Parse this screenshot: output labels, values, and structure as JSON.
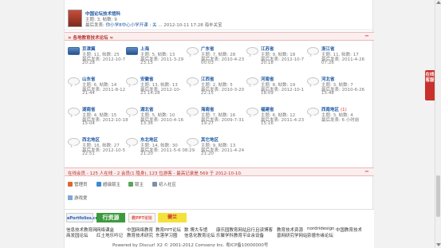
{
  "top": {
    "title": "中国论坛技术馆科",
    "stats": "主题: 3, 帖数: 9",
    "last_prefix": "最后发表:",
    "last_post": "你小学8中心小学开课 : 关",
    "last_time": "... 2012-10-11 17:28 海丰关宝"
  },
  "section": {
    "title": "≈ 各地教育技术论坛 ≈",
    "collapse": "−"
  },
  "cities": [
    {
      "name": "京津冀",
      "new": "",
      "l1": "主题: 11, 帖数: 25",
      "l2": "最后发表: 2012-10-7",
      "l3": "20:28"
    },
    {
      "name": "上海",
      "new": "",
      "l1": "主题: 5, 帖数: 13",
      "l2": "最后发表: 2011-3-29",
      "l3": "23:15"
    },
    {
      "name": "广东省",
      "new": "",
      "l1": "主题: 7, 帖数: 28",
      "l2": "最后发表: 2010-4-23",
      "l3": "00:03"
    },
    {
      "name": "江苏省",
      "new": "",
      "l1": "主题: 9, 帖数: 18",
      "l2": "最后发表: 2012-10-7",
      "l3": "20:18"
    },
    {
      "name": "浙江省",
      "new": "",
      "l1": "主题: 11, 帖数: 17",
      "l2": "最后发表: 2011-4-26",
      "l3": "07:26"
    },
    {
      "name": "山东省",
      "new": "",
      "l1": "主题: 6, 帖数: 14",
      "l2": "最后发表: 2011-8-12",
      "l3": "21:44"
    },
    {
      "name": "安徽省",
      "new": "",
      "l1": "主题: 13, 帖数: 13",
      "l2": "最后发表: 2012-10-",
      "l3": "23 14:28"
    },
    {
      "name": "江西省",
      "new": "",
      "l1": "主题: 2, 帖数: 5",
      "l2": "最后发表: 2010-3-20",
      "l3": "22:15"
    },
    {
      "name": "河南省",
      "new": "",
      "l1": "主题: 8, 帖数: 19",
      "l2": "最后发表: 2012-10-1",
      "l3": "18:09"
    },
    {
      "name": "河北省",
      "new": "",
      "l1": "主题: 3, 帖数: 7",
      "l2": "最后发表: 2010-6-26",
      "l3": "15:48"
    },
    {
      "name": "湖南省",
      "new": "",
      "l1": "主题: 4, 帖数: 15",
      "l2": "最后发表: 2012-10-18",
      "l3": "15:04"
    },
    {
      "name": "湖北省",
      "new": "",
      "l1": "主题: 5, 帖数: 10",
      "l2": "最后发表: 2010-4-16",
      "l3": "13:36"
    },
    {
      "name": "海南省",
      "new": "",
      "l1": "主题: 7, 帖数: 16",
      "l2": "最后发表: 2009-7-31",
      "l3": "19:27"
    },
    {
      "name": "福建省",
      "new": "",
      "l1": "主题: 6, 帖数: 12",
      "l2": "最后发表: 2011-4-23",
      "l3": "15:16"
    },
    {
      "name": "西南地区",
      "new": "(1)",
      "l1": "主题: 3, 帖数: 4",
      "l2": "最后发表: 6 小时前",
      "l3": ""
    },
    {
      "name": "西北地区",
      "new": "",
      "l1": "主题: 16, 帖数: 27",
      "l2": "最后发表: 2012-10-5",
      "l3": "22:51"
    },
    {
      "name": "东北地区",
      "new": "",
      "l1": "主题: 14, 帖数: 30",
      "l2": "最后发表: 2011-5-6 08:29",
      "l3": "21:20"
    },
    {
      "name": "其它地区",
      "new": "",
      "l1": "主题: 9, 帖数: 13",
      "l2": "最后发表: 2011-4-24",
      "l3": "21:20"
    }
  ],
  "online": {
    "text": "在线会员 - 125 人在线 - 2 会员(1 隐身), 123 位游客 - 最高记录是 569 于 2012-10-10.",
    "collapse": "−"
  },
  "legend": [
    {
      "label": "管理员",
      "color": "#e0672b"
    },
    {
      "label": "超级版主",
      "color": "#3a8ad6"
    },
    {
      "label": "版主",
      "color": "#5aa55a"
    },
    {
      "label": "初入社区",
      "color": "#7f8fa6"
    }
  ],
  "guest_label": "游戏爱",
  "logos": {
    "a": "ePortfolios.cn",
    "b": "行资源",
    "c": "教PPT论坛",
    "d": "健兰"
  },
  "links_row1": [
    "信息技术教育网",
    "网络课盒",
    "中国网络教育",
    "教育PPT论坛",
    "数 博大专馆",
    "康乐园教育网站",
    "且行且读博客",
    "教育技术资源",
    "nordridesign",
    "中国教育技术"
  ],
  "links_row2": [
    "商发园论坛",
    "红土地乐吟记",
    "教育技术研究",
    "东落学习圈",
    "信息化教育论坛",
    "乐聚学科教育平",
    "业余设备",
    "普网研究学网站",
    "奈德东缘论坛"
  ],
  "footer": "Powered by Discuz! X2 © 2001-2012 Comsenz Inc. 粤ICP备10000000号",
  "side_tab": "在线客服"
}
